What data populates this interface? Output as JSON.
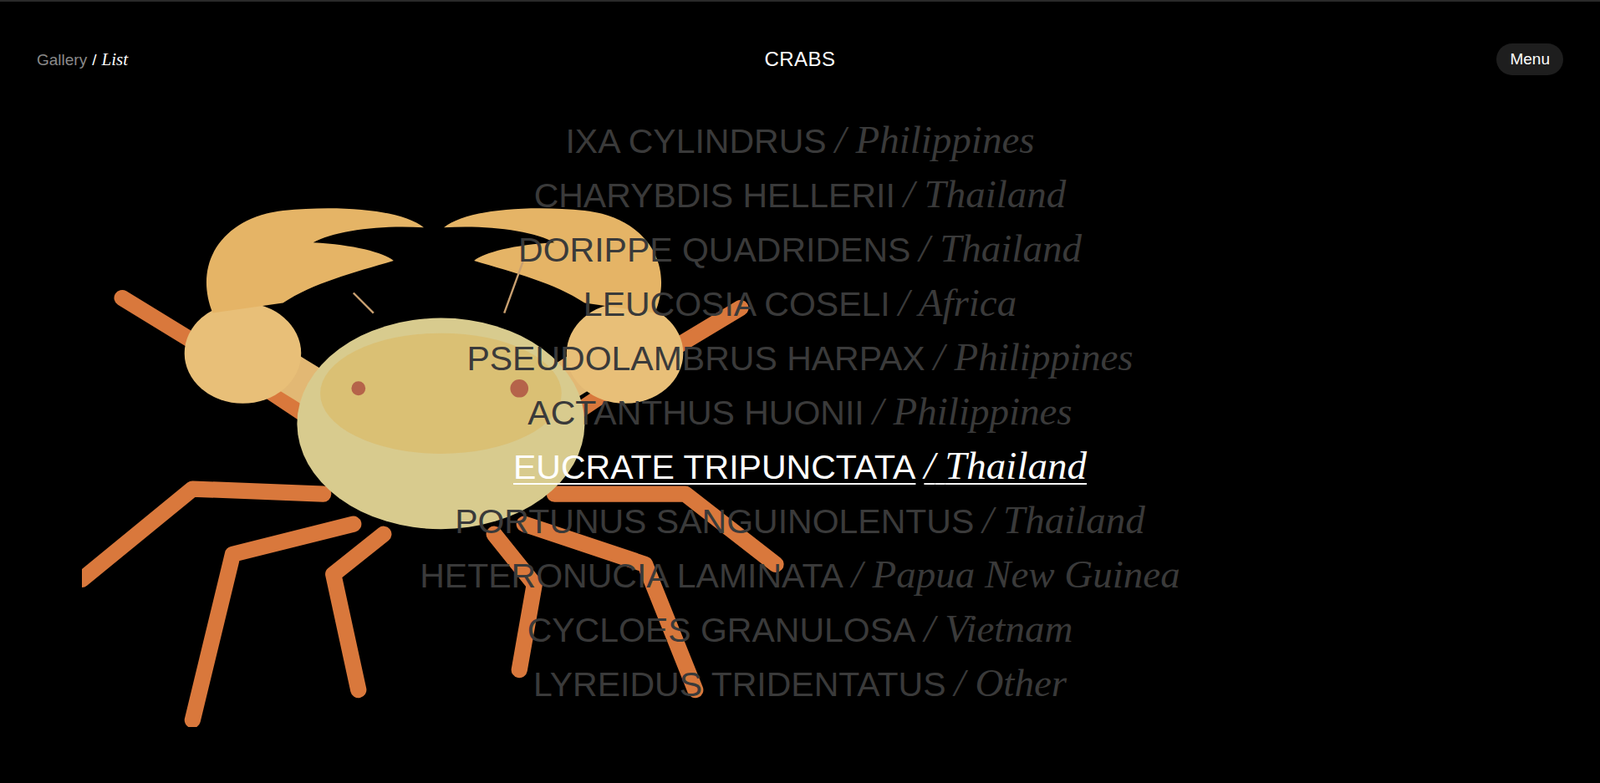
{
  "header": {
    "nav": {
      "items": [
        {
          "label": "Gallery",
          "selected": false
        },
        {
          "label": "List",
          "selected": true
        }
      ],
      "separator": "/"
    },
    "title": "CRABS",
    "menu_button": "Menu"
  },
  "species": {
    "separator": "/",
    "items": [
      {
        "name": "IXA CYLINDRUS",
        "region": "Philippines",
        "selected": false
      },
      {
        "name": "CHARYBDIS HELLERII",
        "region": "Thailand",
        "selected": false
      },
      {
        "name": "DORIPPE QUADRIDENS",
        "region": "Thailand",
        "selected": false
      },
      {
        "name": "LEUCOSIA COSELI",
        "region": "Africa",
        "selected": false
      },
      {
        "name": "PSEUDOLAMBRUS HARPAX",
        "region": "Philippines",
        "selected": false
      },
      {
        "name": "ACTANTHUS HUONII",
        "region": "Philippines",
        "selected": false
      },
      {
        "name": "EUCRATE TRIPUNCTATA",
        "region": "Thailand",
        "selected": true
      },
      {
        "name": "PORTUNUS SANGUINOLENTUS",
        "region": "Thailand",
        "selected": false
      },
      {
        "name": "HETERONUCIA LAMINATA",
        "region": "Papua New Guinea",
        "selected": false
      },
      {
        "name": "CYCLOES GRANULOSA",
        "region": "Vietnam",
        "selected": false
      },
      {
        "name": "LYREIDUS TRIDENTATUS",
        "region": "Other",
        "selected": false
      }
    ]
  }
}
